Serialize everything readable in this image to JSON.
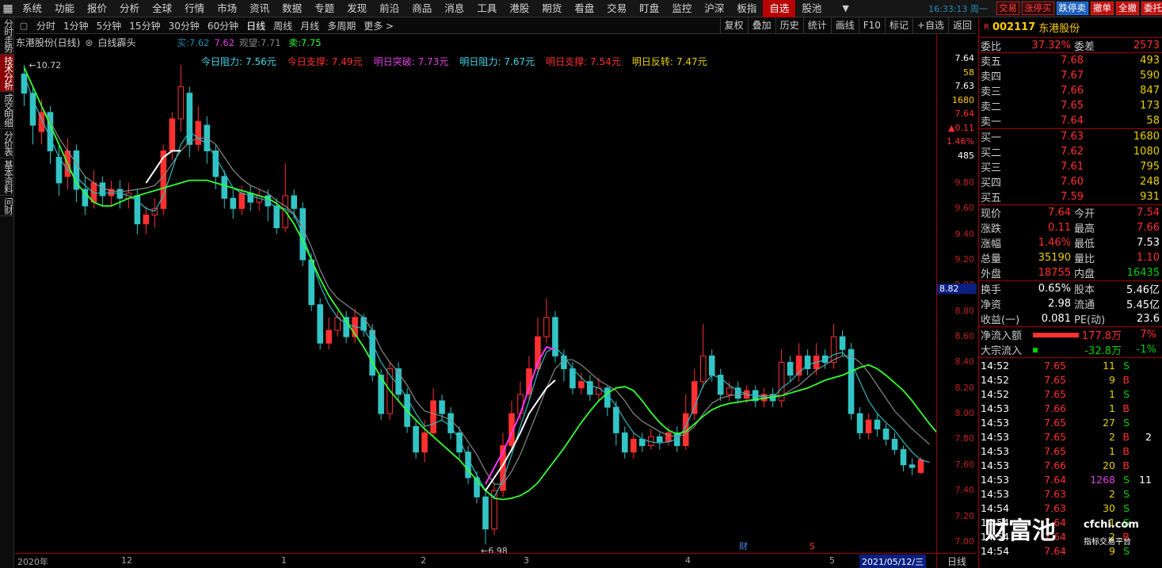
{
  "topbar": {
    "logo": "▦",
    "menu": [
      "系统",
      "功能",
      "报价",
      "分析",
      "全球",
      "行情",
      "市场",
      "资讯",
      "数据",
      "专题",
      "发现",
      "前沿",
      "商品",
      "消息",
      "工具",
      "港股",
      "期货",
      "看盘",
      "交易",
      "盯盘",
      "监控",
      "沪深",
      "板指",
      "自选",
      "股池"
    ],
    "active_menu": "自选",
    "arrow": "▼",
    "clock": "16:33:13 周一",
    "quick_buttons": [
      "交易",
      "涨停买",
      "跌停卖",
      "撤单",
      "全撤",
      "委托"
    ]
  },
  "sidetabs": [
    "分时走势",
    "技术分析",
    "成交明细",
    "分价表",
    "基本资料",
    "问财"
  ],
  "active_sidetab": "技术分析",
  "periodbar": {
    "items": [
      "分时",
      "1分钟",
      "5分钟",
      "15分钟",
      "30分钟",
      "60分钟",
      "日线",
      "周线",
      "月线",
      "多周期",
      "更多 >"
    ],
    "active": "日线",
    "tools": [
      "复权",
      "叠加",
      "历史",
      "统计",
      "画线",
      "F10",
      "标记",
      "+自选",
      "返回"
    ]
  },
  "chart_header": {
    "stock": "东港股份(日线)",
    "indicator": "白线霹头",
    "buy_label": "买:",
    "buy_val": "7.62",
    "mid_val": "7.62",
    "watch_label": "观望:",
    "watch_val": "7.71",
    "sell_label": "卖:",
    "sell_val": "7.75"
  },
  "levels": [
    {
      "label": "今日阻力:",
      "value": "7.56元",
      "color": "cyan"
    },
    {
      "label": "今日支撑:",
      "value": "7.49元",
      "color": "red"
    },
    {
      "label": "明日突破:",
      "value": "7.73元",
      "color": "magenta"
    },
    {
      "label": "明日阻力:",
      "value": "7.67元",
      "color": "cyan"
    },
    {
      "label": "明日支撑:",
      "value": "7.54元",
      "color": "red"
    },
    {
      "label": "明日反转:",
      "value": "7.47元",
      "color": "yellow"
    }
  ],
  "annotations": {
    "high": "10.72",
    "low": "6.98",
    "marker_cai": "财",
    "marker_s": "S"
  },
  "xaxis": {
    "labels": [
      "2020年",
      "12",
      "1",
      "2",
      "3",
      "4",
      "5"
    ],
    "current_date": "2021/05/12/三",
    "period": "日线"
  },
  "price_axis": {
    "ticks": [
      "9.80",
      "9.60",
      "9.40",
      "9.20",
      "9.00",
      "8.80",
      "8.60",
      "8.40",
      "8.20",
      "8.00",
      "7.80",
      "7.60",
      "7.40",
      "7.20",
      "7.00"
    ],
    "cursor_price": "8.82"
  },
  "mini_col": [
    "7.64",
    "58",
    "7.63",
    "1680",
    "7.64",
    "▲0.11",
    "1.46%",
    "485"
  ],
  "quote": {
    "code": "002117",
    "name": "东港股份",
    "webi_label": "委比",
    "webi": "37.32%",
    "weicha_label": "委差",
    "weicha": "2573",
    "asks": [
      {
        "label": "卖五",
        "price": "7.68",
        "vol": "493"
      },
      {
        "label": "卖四",
        "price": "7.67",
        "vol": "590"
      },
      {
        "label": "卖三",
        "price": "7.66",
        "vol": "847"
      },
      {
        "label": "卖二",
        "price": "7.65",
        "vol": "173"
      },
      {
        "label": "卖一",
        "price": "7.64",
        "vol": "58"
      }
    ],
    "bids": [
      {
        "label": "买一",
        "price": "7.63",
        "vol": "1680"
      },
      {
        "label": "买二",
        "price": "7.62",
        "vol": "1080"
      },
      {
        "label": "买三",
        "price": "7.61",
        "vol": "795"
      },
      {
        "label": "买四",
        "price": "7.60",
        "vol": "248"
      },
      {
        "label": "买五",
        "price": "7.59",
        "vol": "931"
      }
    ],
    "stats": [
      {
        "l1": "现价",
        "v1": "7.64",
        "c1": "red",
        "l2": "今开",
        "v2": "7.54",
        "c2": "red"
      },
      {
        "l1": "涨跌",
        "v1": "0.11",
        "c1": "red",
        "l2": "最高",
        "v2": "7.66",
        "c2": "red"
      },
      {
        "l1": "涨幅",
        "v1": "1.46%",
        "c1": "red",
        "l2": "最低",
        "v2": "7.53",
        "c2": "white"
      },
      {
        "l1": "总量",
        "v1": "35190",
        "c1": "yellow",
        "l2": "量比",
        "v2": "1.10",
        "c2": "red"
      },
      {
        "l1": "外盘",
        "v1": "18755",
        "c1": "red",
        "l2": "内盘",
        "v2": "16435",
        "c2": "green"
      }
    ],
    "stats2": [
      {
        "l1": "换手",
        "v1": "0.65%",
        "l2": "股本",
        "v2": "5.46亿"
      },
      {
        "l1": "净资",
        "v1": "2.98",
        "l2": "流通",
        "v2": "5.45亿"
      },
      {
        "l1": "收益(一)",
        "v1": "0.081",
        "l2": "PE(动)",
        "v2": "23.6"
      }
    ],
    "flow": [
      {
        "label": "净流入额",
        "amount": "177.8万",
        "pct": "7%",
        "color": "red"
      },
      {
        "label": "大宗流入",
        "amount": "-32.8万",
        "pct": "-1%",
        "color": "green"
      }
    ],
    "ticks": [
      {
        "t": "14:52",
        "p": "7.65",
        "v": "11",
        "s": "S",
        "x": ""
      },
      {
        "t": "14:52",
        "p": "7.65",
        "v": "9",
        "s": "B",
        "x": ""
      },
      {
        "t": "14:52",
        "p": "7.65",
        "v": "1",
        "s": "S",
        "x": ""
      },
      {
        "t": "14:53",
        "p": "7.66",
        "v": "1",
        "s": "B",
        "x": ""
      },
      {
        "t": "14:53",
        "p": "7.65",
        "v": "27",
        "s": "S",
        "x": ""
      },
      {
        "t": "14:53",
        "p": "7.65",
        "v": "2",
        "s": "B",
        "x": "2"
      },
      {
        "t": "14:53",
        "p": "7.65",
        "v": "1",
        "s": "B",
        "x": ""
      },
      {
        "t": "14:53",
        "p": "7.66",
        "v": "20",
        "s": "B",
        "x": ""
      },
      {
        "t": "14:53",
        "p": "7.64",
        "v": "1268",
        "s": "S",
        "x": "11"
      },
      {
        "t": "14:53",
        "p": "7.63",
        "v": "2",
        "s": "S",
        "x": ""
      },
      {
        "t": "14:54",
        "p": "7.63",
        "v": "30",
        "s": "S",
        "x": ""
      },
      {
        "t": "14:54",
        "p": "7.64",
        "v": "1",
        "s": "S",
        "x": ""
      },
      {
        "t": "14:54",
        "p": "7.64",
        "v": "2",
        "s": "B",
        "x": ""
      },
      {
        "t": "14:54",
        "p": "7.64",
        "v": "9",
        "s": "S",
        "x": ""
      }
    ]
  },
  "watermark": {
    "brand": "财富池",
    "site": "cfchi.com",
    "sub": "指标交易平台"
  },
  "colors": {
    "up": "#ff3030",
    "down": "#33c5c5",
    "ma_green": "#33ff33",
    "ma_gray": "#888888",
    "white_line": "#ffffff",
    "magenta_line": "#ff33ff",
    "axis": "#a00000"
  },
  "chart_data": {
    "type": "candlestick",
    "ylim": [
      6.95,
      10.85
    ],
    "y_ticks": [
      9.8,
      9.6,
      9.4,
      9.2,
      9.0,
      8.8,
      8.6,
      8.4,
      8.2,
      8.0,
      7.8,
      7.6,
      7.4,
      7.2,
      7.0
    ],
    "annot_high": 10.72,
    "annot_low": 6.98,
    "candles": [
      [
        10.65,
        10.5,
        10.72,
        10.4
      ],
      [
        10.5,
        10.25,
        10.55,
        10.1
      ],
      [
        10.2,
        10.35,
        10.45,
        10.1
      ],
      [
        10.35,
        10.05,
        10.4,
        9.95
      ],
      [
        10.0,
        9.8,
        10.1,
        9.7
      ],
      [
        9.85,
        10.05,
        10.15,
        9.75
      ],
      [
        10.05,
        9.75,
        10.1,
        9.65
      ],
      [
        9.75,
        9.62,
        9.85,
        9.55
      ],
      [
        9.65,
        9.8,
        9.9,
        9.6
      ],
      [
        9.8,
        9.7,
        9.85,
        9.62
      ],
      [
        9.7,
        9.75,
        9.82,
        9.62
      ],
      [
        9.75,
        9.68,
        9.82,
        9.6
      ],
      [
        9.68,
        9.72,
        9.8,
        9.6
      ],
      [
        9.7,
        9.48,
        9.75,
        9.4
      ],
      [
        9.48,
        9.55,
        9.62,
        9.4
      ],
      [
        9.55,
        9.6,
        9.68,
        9.45
      ],
      [
        9.6,
        10.05,
        10.1,
        9.55
      ],
      [
        10.05,
        10.3,
        10.35,
        9.98
      ],
      [
        10.3,
        10.55,
        10.72,
        10.2
      ],
      [
        10.5,
        10.1,
        10.55,
        10.0
      ],
      [
        10.1,
        10.28,
        10.4,
        10.05
      ],
      [
        10.25,
        10.05,
        10.32,
        9.95
      ],
      [
        10.05,
        9.85,
        10.1,
        9.75
      ],
      [
        9.85,
        9.68,
        9.9,
        9.6
      ],
      [
        9.68,
        9.6,
        9.75,
        9.52
      ],
      [
        9.6,
        9.72,
        9.78,
        9.55
      ],
      [
        9.72,
        9.65,
        9.78,
        9.58
      ],
      [
        9.65,
        9.7,
        9.75,
        9.58
      ],
      [
        9.7,
        9.62,
        9.75,
        9.5
      ],
      [
        9.62,
        9.45,
        9.68,
        9.4
      ],
      [
        9.45,
        9.7,
        9.95,
        9.42
      ],
      [
        9.7,
        9.6,
        9.75,
        9.52
      ],
      [
        9.6,
        9.2,
        9.65,
        9.15
      ],
      [
        9.2,
        8.85,
        9.25,
        8.8
      ],
      [
        8.85,
        8.55,
        8.9,
        8.5
      ],
      [
        8.55,
        8.65,
        8.75,
        8.5
      ],
      [
        8.65,
        8.75,
        8.8,
        8.6
      ],
      [
        8.75,
        8.6,
        8.8,
        8.55
      ],
      [
        8.6,
        8.75,
        8.82,
        8.55
      ],
      [
        8.75,
        8.65,
        8.78,
        8.6
      ],
      [
        8.65,
        8.3,
        8.7,
        8.25
      ],
      [
        8.3,
        8.0,
        8.35,
        7.95
      ],
      [
        8.0,
        8.35,
        8.4,
        7.95
      ],
      [
        8.35,
        8.15,
        8.4,
        8.1
      ],
      [
        8.15,
        7.9,
        8.2,
        7.85
      ],
      [
        7.9,
        7.7,
        7.95,
        7.65
      ],
      [
        7.7,
        7.85,
        7.95,
        7.62
      ],
      [
        7.85,
        8.1,
        8.2,
        7.82
      ],
      [
        8.1,
        8.0,
        8.15,
        7.95
      ],
      [
        8.0,
        7.85,
        8.05,
        7.8
      ],
      [
        7.85,
        7.7,
        7.9,
        7.65
      ],
      [
        7.7,
        7.5,
        7.75,
        7.45
      ],
      [
        7.5,
        7.35,
        7.55,
        7.3
      ],
      [
        7.35,
        7.1,
        7.4,
        6.98
      ],
      [
        7.1,
        7.4,
        7.45,
        7.05
      ],
      [
        7.4,
        7.75,
        7.85,
        7.35
      ],
      [
        7.75,
        8.0,
        8.1,
        7.7
      ],
      [
        8.0,
        8.15,
        8.25,
        7.95
      ],
      [
        8.15,
        8.35,
        8.45,
        8.1
      ],
      [
        8.35,
        8.6,
        8.75,
        8.3
      ],
      [
        8.6,
        8.75,
        8.9,
        8.55
      ],
      [
        8.75,
        8.45,
        8.8,
        8.4
      ],
      [
        8.45,
        8.35,
        8.5,
        8.25
      ],
      [
        8.35,
        8.2,
        8.4,
        8.15
      ],
      [
        8.2,
        8.25,
        8.32,
        8.15
      ],
      [
        8.25,
        8.15,
        8.3,
        8.1
      ],
      [
        8.15,
        8.2,
        8.28,
        8.1
      ],
      [
        8.2,
        8.05,
        8.22,
        7.98
      ],
      [
        8.05,
        7.85,
        8.1,
        7.75
      ],
      [
        7.85,
        7.7,
        7.9,
        7.65
      ],
      [
        7.7,
        7.8,
        7.85,
        7.65
      ],
      [
        7.8,
        7.75,
        7.85,
        7.7
      ],
      [
        7.75,
        7.82,
        7.88,
        7.72
      ],
      [
        7.82,
        7.78,
        7.85,
        7.72
      ],
      [
        7.78,
        7.85,
        7.9,
        7.75
      ],
      [
        7.85,
        7.75,
        7.9,
        7.7
      ],
      [
        7.75,
        8.0,
        8.15,
        7.72
      ],
      [
        8.0,
        8.25,
        8.35,
        7.95
      ],
      [
        8.25,
        8.45,
        8.7,
        8.2
      ],
      [
        8.45,
        8.3,
        8.5,
        8.25
      ],
      [
        8.3,
        8.15,
        8.35,
        8.1
      ],
      [
        8.15,
        8.2,
        8.25,
        8.1
      ],
      [
        8.2,
        8.12,
        8.25,
        8.08
      ],
      [
        8.12,
        8.18,
        8.22,
        8.08
      ],
      [
        8.18,
        8.1,
        8.22,
        8.05
      ],
      [
        8.1,
        8.15,
        8.2,
        8.05
      ],
      [
        8.15,
        8.1,
        8.2,
        8.05
      ],
      [
        8.1,
        8.4,
        8.5,
        8.05
      ],
      [
        8.4,
        8.3,
        8.45,
        8.25
      ],
      [
        8.3,
        8.45,
        8.55,
        8.25
      ],
      [
        8.45,
        8.35,
        8.5,
        8.3
      ],
      [
        8.35,
        8.45,
        8.55,
        8.3
      ],
      [
        8.45,
        8.4,
        8.5,
        8.35
      ],
      [
        8.4,
        8.6,
        8.7,
        8.35
      ],
      [
        8.6,
        8.5,
        8.65,
        8.45
      ],
      [
        8.5,
        8.0,
        8.55,
        7.95
      ],
      [
        8.0,
        7.85,
        8.05,
        7.8
      ],
      [
        7.85,
        7.95,
        8.0,
        7.8
      ],
      [
        7.95,
        7.88,
        8.0,
        7.82
      ],
      [
        7.88,
        7.8,
        7.92,
        7.75
      ],
      [
        7.8,
        7.72,
        7.85,
        7.68
      ],
      [
        7.72,
        7.6,
        7.75,
        7.55
      ],
      [
        7.6,
        7.58,
        7.65,
        7.52
      ],
      [
        7.54,
        7.64,
        7.66,
        7.53
      ]
    ],
    "ma_green": [
      10.7,
      10.55,
      10.4,
      10.25,
      10.1,
      9.95,
      9.8,
      9.72,
      9.65,
      9.62,
      9.62,
      9.65,
      9.68,
      9.7,
      9.72,
      9.74,
      9.76,
      9.78,
      9.8,
      9.82,
      9.82,
      9.82,
      9.8,
      9.78,
      9.76,
      9.74,
      9.72,
      9.7,
      9.68,
      9.64,
      9.58,
      9.48,
      9.35,
      9.2,
      9.05,
      8.92,
      8.82,
      8.72,
      8.62,
      8.52,
      8.4,
      8.28,
      8.18,
      8.1,
      8.02,
      7.95,
      7.88,
      7.82,
      7.76,
      7.7,
      7.64,
      7.56,
      7.48,
      7.4,
      7.34,
      7.33,
      7.34,
      7.36,
      7.4,
      7.46,
      7.55,
      7.64,
      7.73,
      7.83,
      7.93,
      8.02,
      8.1,
      8.16,
      8.2,
      8.21,
      8.18,
      8.1,
      8.01,
      7.93,
      7.87,
      7.84,
      7.86,
      7.92,
      7.98,
      8.03,
      8.06,
      8.08,
      8.09,
      8.1,
      8.11,
      8.12,
      8.13,
      8.14,
      8.16,
      8.18,
      8.2,
      8.23,
      8.26,
      8.28,
      8.3,
      8.33,
      8.36,
      8.38,
      8.35,
      8.3,
      8.24,
      8.18,
      8.1,
      8.01,
      7.92,
      7.84,
      7.78
    ],
    "ma_gray": [
      10.7,
      10.55,
      10.4,
      10.28,
      10.15,
      10.05,
      9.95,
      9.85,
      9.8,
      9.76,
      9.74,
      9.73,
      9.74,
      9.75,
      9.76,
      9.78,
      9.85,
      9.95,
      10.05,
      10.12,
      10.15,
      10.15,
      10.1,
      10.0,
      9.9,
      9.83,
      9.78,
      9.75,
      9.72,
      9.66,
      9.62,
      9.56,
      9.45,
      9.3,
      9.12,
      8.98,
      8.9,
      8.85,
      8.8,
      8.75,
      8.65,
      8.5,
      8.4,
      8.32,
      8.22,
      8.1,
      8.02,
      8.0,
      7.98,
      7.95,
      7.88,
      7.78,
      7.68,
      7.55,
      7.45,
      7.45,
      7.55,
      7.68,
      7.85,
      8.02,
      8.2,
      8.35,
      8.42,
      8.42,
      8.38,
      8.32,
      8.26,
      8.22,
      8.18,
      8.1,
      8.0,
      7.94,
      7.9,
      7.86,
      7.83,
      7.82,
      7.84,
      7.9,
      8.0,
      8.08,
      8.12,
      8.14,
      8.15,
      8.15,
      8.14,
      8.14,
      8.14,
      8.14,
      8.18,
      8.22,
      8.28,
      8.34,
      8.38,
      8.42,
      8.45,
      8.45,
      8.4,
      8.32,
      8.22,
      8.12,
      8.02,
      7.95,
      7.88,
      7.82,
      7.76
    ],
    "ma_cyan": [
      10.65,
      10.45,
      10.3,
      10.15,
      10.0,
      9.9,
      9.85,
      9.78,
      9.72,
      9.72,
      9.72,
      9.72,
      9.7,
      9.66,
      9.6,
      9.58,
      9.7,
      9.9,
      10.1,
      10.2,
      10.15,
      10.1,
      10.0,
      9.88,
      9.76,
      9.72,
      9.7,
      9.68,
      9.66,
      9.6,
      9.6,
      9.55,
      9.4,
      9.2,
      9.0,
      8.85,
      8.75,
      8.7,
      8.68,
      8.66,
      8.55,
      8.4,
      8.3,
      8.22,
      8.12,
      8.0,
      7.9,
      7.92,
      7.95,
      7.9,
      7.8,
      7.65,
      7.52,
      7.4,
      7.35,
      7.48,
      7.68,
      7.9,
      8.1,
      8.32,
      8.48,
      8.52,
      8.45,
      8.35,
      8.28,
      8.22,
      8.2,
      8.15,
      8.06,
      7.95,
      7.85,
      7.8,
      7.78,
      7.77,
      7.78,
      7.8,
      7.9,
      8.05,
      8.22,
      8.3,
      8.28,
      8.22,
      8.18,
      8.15,
      8.14,
      8.13,
      8.12,
      8.2,
      8.25,
      8.32,
      8.38,
      8.4,
      8.42,
      8.46,
      8.48,
      8.4,
      8.25,
      8.1,
      8.0,
      7.93,
      7.87,
      7.78,
      7.7,
      7.64,
      7.62
    ],
    "white_line": {
      "start": 14,
      "values": [
        9.8,
        9.9,
        10.0,
        10.05,
        10.05
      ]
    },
    "white_line2": {
      "start": 53,
      "values": [
        7.4,
        7.5,
        7.6,
        7.72,
        7.85,
        8.0,
        8.1,
        8.2,
        8.26
      ]
    },
    "magenta_line": {
      "start": 53,
      "values": [
        7.45,
        7.58,
        7.7,
        7.85,
        8.0,
        8.2,
        8.4,
        8.52,
        8.5
      ]
    }
  }
}
